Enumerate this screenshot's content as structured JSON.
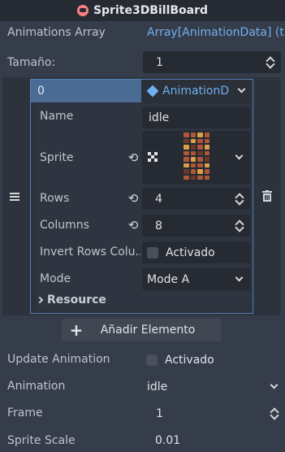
{
  "title": "Sprite3DBillBoard",
  "animations_array": {
    "label": "Animations Array",
    "value": "Array[AnimationData] (t"
  },
  "size": {
    "label": "Tamaño:",
    "value": "1"
  },
  "element": {
    "index": "0",
    "type_label": "AnimationD",
    "name": {
      "label": "Name",
      "value": "idle"
    },
    "sprite": {
      "label": "Sprite"
    },
    "rows": {
      "label": "Rows",
      "value": "4"
    },
    "columns": {
      "label": "Columns",
      "value": "8"
    },
    "invert": {
      "label": "Invert Rows Colu...",
      "value": "Activado"
    },
    "mode": {
      "label": "Mode",
      "value": "Mode A"
    },
    "resource": {
      "label": "Resource"
    }
  },
  "add_button": {
    "label": "Añadir Elemento"
  },
  "update_animation": {
    "label": "Update Animation",
    "value": "Activado"
  },
  "animation": {
    "label": "Animation",
    "value": "idle"
  },
  "frame": {
    "label": "Frame",
    "value": "1"
  },
  "sprite_scale": {
    "label": "Sprite Scale",
    "value": "0.01"
  },
  "colors": {
    "background": "#363d4a",
    "field": "#252a33",
    "accent": "#5680b6",
    "link": "#6fb0f0"
  }
}
